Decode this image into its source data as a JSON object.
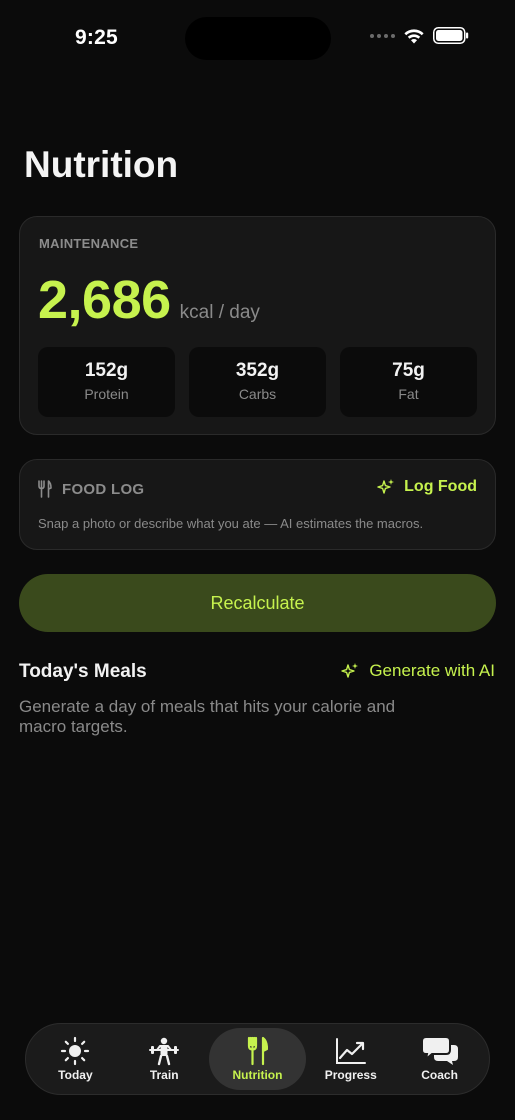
{
  "status_bar": {
    "time": "9:25"
  },
  "page": {
    "title": "Nutrition"
  },
  "maintenance": {
    "label": "MAINTENANCE",
    "calories": "2,686",
    "unit": "kcal / day",
    "macros": [
      {
        "value": "152g",
        "label": "Protein"
      },
      {
        "value": "352g",
        "label": "Carbs"
      },
      {
        "value": "75g",
        "label": "Fat"
      }
    ]
  },
  "food_log": {
    "title": "FOOD LOG",
    "action": "Log Food",
    "description": "Snap a photo or describe what you ate — AI estimates the macros."
  },
  "recalculate_label": "Recalculate",
  "meals": {
    "title": "Today's Meals",
    "action": "Generate with AI",
    "description": "Generate a day of meals that hits your calorie and macro targets."
  },
  "tabs": [
    {
      "label": "Today",
      "icon": "sun-icon",
      "active": false
    },
    {
      "label": "Train",
      "icon": "weightlifter-icon",
      "active": false
    },
    {
      "label": "Nutrition",
      "icon": "fork-knife-icon",
      "active": true
    },
    {
      "label": "Progress",
      "icon": "chart-line-icon",
      "active": false
    },
    {
      "label": "Coach",
      "icon": "chat-bubbles-icon",
      "active": false
    }
  ],
  "colors": {
    "accent": "#c6f24e",
    "background": "#0b0b0b",
    "card": "#171717",
    "button": "#3a4a1c"
  }
}
